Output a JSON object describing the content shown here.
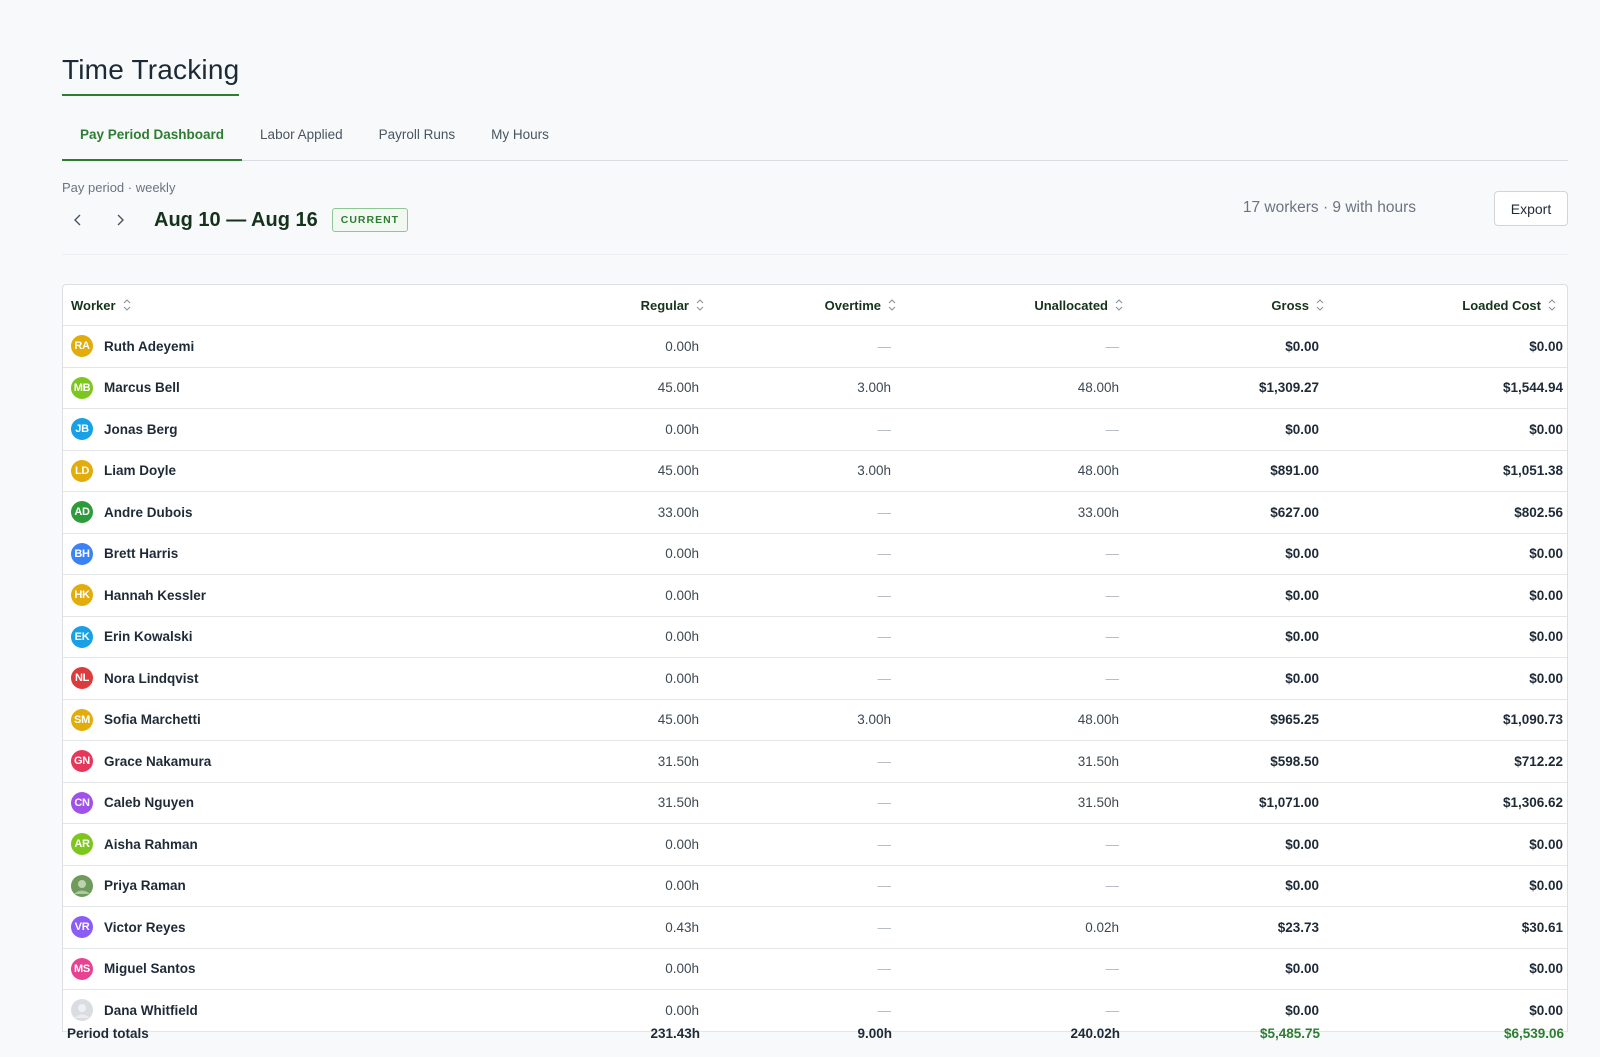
{
  "page": {
    "title": "Time Tracking"
  },
  "tabs": [
    {
      "label": "Pay Period Dashboard",
      "active": true
    },
    {
      "label": "Labor Applied",
      "active": false
    },
    {
      "label": "Payroll Runs",
      "active": false
    },
    {
      "label": "My Hours",
      "active": false
    }
  ],
  "period": {
    "label": "Pay period · weekly",
    "range": "Aug 10 — Aug 16",
    "badge": "CURRENT",
    "summary": "17 workers · 9 with hours",
    "export_label": "Export"
  },
  "table": {
    "columns": [
      "Worker",
      "Regular",
      "Overtime",
      "Unallocated",
      "Gross",
      "Loaded Cost"
    ],
    "rows": [
      {
        "initials": "RA",
        "color": "#e2ac0b",
        "name": "Ruth Adeyemi",
        "regular": "0.00h",
        "overtime": "—",
        "unallocated": "—",
        "gross": "$0.00",
        "loaded": "$0.00"
      },
      {
        "initials": "MB",
        "color": "#7cc61d",
        "name": "Marcus Bell",
        "regular": "45.00h",
        "overtime": "3.00h",
        "unallocated": "48.00h",
        "gross": "$1,309.27",
        "loaded": "$1,544.94"
      },
      {
        "initials": "JB",
        "color": "#17a0e3",
        "name": "Jonas Berg",
        "regular": "0.00h",
        "overtime": "—",
        "unallocated": "—",
        "gross": "$0.00",
        "loaded": "$0.00"
      },
      {
        "initials": "LD",
        "color": "#e2ac0b",
        "name": "Liam Doyle",
        "regular": "45.00h",
        "overtime": "3.00h",
        "unallocated": "48.00h",
        "gross": "$891.00",
        "loaded": "$1,051.38"
      },
      {
        "initials": "AD",
        "color": "#2e9b3a",
        "name": "Andre Dubois",
        "regular": "33.00h",
        "overtime": "—",
        "unallocated": "33.00h",
        "gross": "$627.00",
        "loaded": "$802.56"
      },
      {
        "initials": "BH",
        "color": "#3b82f6",
        "name": "Brett Harris",
        "regular": "0.00h",
        "overtime": "—",
        "unallocated": "—",
        "gross": "$0.00",
        "loaded": "$0.00"
      },
      {
        "initials": "HK",
        "color": "#e2ac0b",
        "name": "Hannah Kessler",
        "regular": "0.00h",
        "overtime": "—",
        "unallocated": "—",
        "gross": "$0.00",
        "loaded": "$0.00"
      },
      {
        "initials": "EK",
        "color": "#17a0e3",
        "name": "Erin Kowalski",
        "regular": "0.00h",
        "overtime": "—",
        "unallocated": "—",
        "gross": "$0.00",
        "loaded": "$0.00"
      },
      {
        "initials": "NL",
        "color": "#dc3b3b",
        "name": "Nora Lindqvist",
        "regular": "0.00h",
        "overtime": "—",
        "unallocated": "—",
        "gross": "$0.00",
        "loaded": "$0.00"
      },
      {
        "initials": "SM",
        "color": "#e2ac0b",
        "name": "Sofia Marchetti",
        "regular": "45.00h",
        "overtime": "3.00h",
        "unallocated": "48.00h",
        "gross": "$965.25",
        "loaded": "$1,090.73"
      },
      {
        "initials": "GN",
        "color": "#e8365a",
        "name": "Grace Nakamura",
        "regular": "31.50h",
        "overtime": "—",
        "unallocated": "31.50h",
        "gross": "$598.50",
        "loaded": "$712.22"
      },
      {
        "initials": "CN",
        "color": "#a052e8",
        "name": "Caleb Nguyen",
        "regular": "31.50h",
        "overtime": "—",
        "unallocated": "31.50h",
        "gross": "$1,071.00",
        "loaded": "$1,306.62"
      },
      {
        "initials": "AR",
        "color": "#7cc61d",
        "name": "Aisha Rahman",
        "regular": "0.00h",
        "overtime": "—",
        "unallocated": "—",
        "gross": "$0.00",
        "loaded": "$0.00"
      },
      {
        "initials": "",
        "color": "#6e9a5a",
        "name": "Priya Raman",
        "photo": true,
        "regular": "0.00h",
        "overtime": "—",
        "unallocated": "—",
        "gross": "$0.00",
        "loaded": "$0.00"
      },
      {
        "initials": "VR",
        "color": "#8b5cf6",
        "name": "Victor Reyes",
        "regular": "0.43h",
        "overtime": "—",
        "unallocated": "0.02h",
        "gross": "$23.73",
        "loaded": "$30.61"
      },
      {
        "initials": "MS",
        "color": "#e84393",
        "name": "Miguel Santos",
        "regular": "0.00h",
        "overtime": "—",
        "unallocated": "—",
        "gross": "$0.00",
        "loaded": "$0.00"
      },
      {
        "initials": "",
        "color": "#d9dde2",
        "name": "Dana Whitfield",
        "photo": true,
        "regular": "0.00h",
        "overtime": "—",
        "unallocated": "—",
        "gross": "$0.00",
        "loaded": "$0.00"
      }
    ],
    "totals": {
      "label": "Period totals",
      "regular": "231.43h",
      "overtime": "9.00h",
      "unallocated": "240.02h",
      "gross": "$5,485.75",
      "loaded": "$6,539.06"
    }
  },
  "colors": {
    "accent": "#2e7d32"
  }
}
